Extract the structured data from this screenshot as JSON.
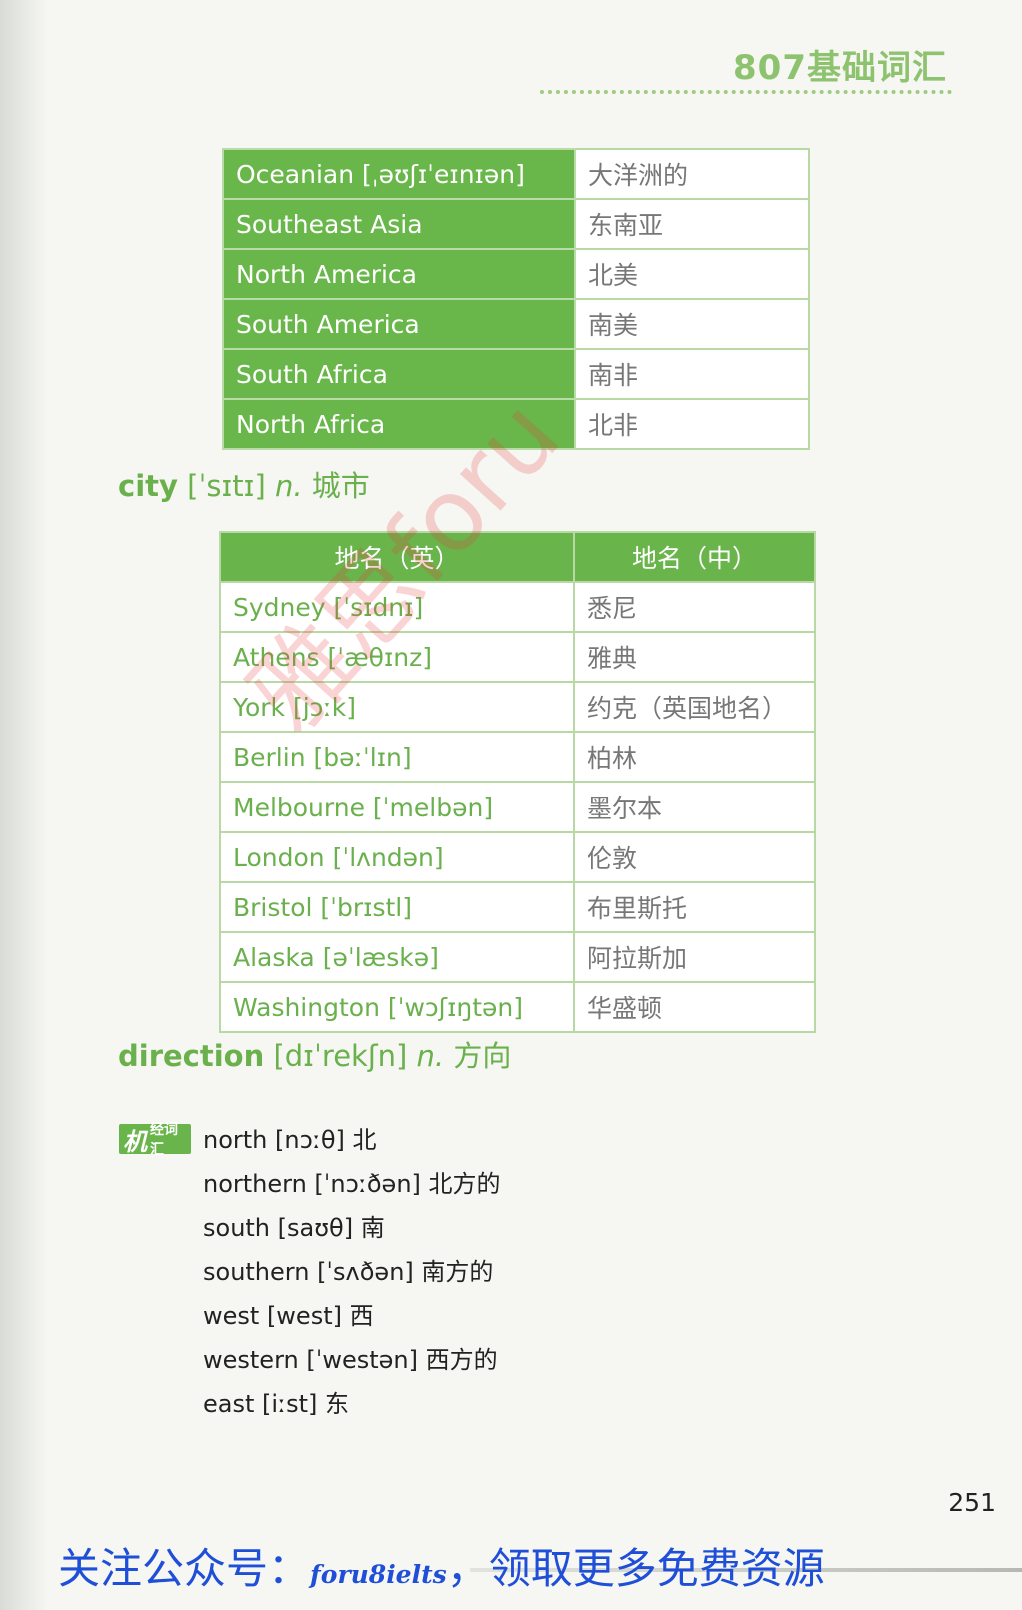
{
  "header": {
    "title": "807基础词汇"
  },
  "regions": [
    {
      "en": "Oceanian [ˌəʊʃɪˈeɪnɪən]",
      "zh": "大洋洲的"
    },
    {
      "en": "Southeast Asia",
      "zh": "东南亚"
    },
    {
      "en": "North America",
      "zh": "北美"
    },
    {
      "en": "South America",
      "zh": "南美"
    },
    {
      "en": "South Africa",
      "zh": "南非"
    },
    {
      "en": "North Africa",
      "zh": "北非"
    }
  ],
  "city_entry": {
    "word": "city",
    "phon": " [ˈsɪtɪ] ",
    "pos": "n.",
    "zh": " 城市"
  },
  "city_table": {
    "headers": [
      "地名（英）",
      "地名（中）"
    ],
    "rows": [
      {
        "en": "Sydney [ˈsɪdnɪ]",
        "zh": "悉尼"
      },
      {
        "en": "Athens [ˈæθɪnz]",
        "zh": "雅典"
      },
      {
        "en": "York [jɔːk]",
        "zh": "约克（英国地名）"
      },
      {
        "en": "Berlin [bəːˈlɪn]",
        "zh": "柏林"
      },
      {
        "en": "Melbourne [ˈmelbən]",
        "zh": "墨尔本"
      },
      {
        "en": "London [ˈlʌndən]",
        "zh": "伦敦"
      },
      {
        "en": "Bristol [ˈbrɪstl]",
        "zh": "布里斯托"
      },
      {
        "en": "Alaska [əˈlæskə]",
        "zh": "阿拉斯加"
      },
      {
        "en": "Washington [ˈwɔʃɪŋtən]",
        "zh": "华盛顿"
      }
    ]
  },
  "direction_entry": {
    "word": "direction",
    "phon": " [dɪˈrekʃn] ",
    "pos": "n.",
    "zh": " 方向"
  },
  "badge": {
    "big": "机",
    "small": "经词汇"
  },
  "direction_words": [
    "north [nɔːθ] 北",
    "northern [ˈnɔːðən] 北方的",
    "south [saʊθ] 南",
    "southern [ˈsʌðən] 南方的",
    "west [west] 西",
    "western [ˈwestən] 西方的",
    "east [iːst] 东"
  ],
  "page_number": "251",
  "watermark": "雅思foru",
  "promo": {
    "text1": "关注公众号：",
    "handle": "foru8ielts",
    "text2": "，领取更多免费资源"
  }
}
